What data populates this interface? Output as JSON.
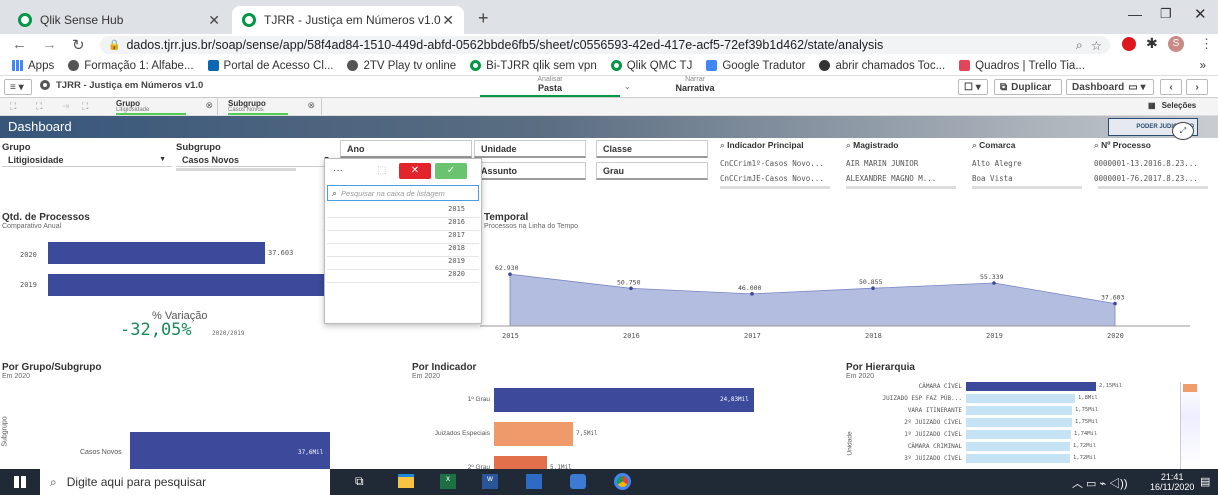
{
  "browser": {
    "tabs": [
      {
        "label": "Qlik Sense Hub"
      },
      {
        "label": "TJRR - Justiça em Números v1.0 -"
      }
    ],
    "url": "dados.tjrr.jus.br/soap/sense/app/58f4ad84-1510-449d-abfd-0562bbde6fb5/sheet/c0556593-42ed-417e-acf5-72ef39b1d462/state/analysis",
    "bookmarks": [
      "Apps",
      "Formação 1: Alfabe...",
      "Portal de Acesso Cl...",
      "2TV Play tv online",
      "Bi-TJRR qlik sem vpn",
      "Qlik QMC TJ",
      "Google Tradutor",
      "abrir chamados Toc...",
      "Quadros | Trello Tia..."
    ],
    "bookmarks_more": "»",
    "profile": "S"
  },
  "qlik": {
    "app_name": "TJRR - Justiça em Números v1.0",
    "analisar": "Analisar",
    "pasta": "Pasta",
    "narrar": "Narrar",
    "narrativa": "Narrativa",
    "duplicar": "Duplicar",
    "dashboard_btn": "Dashboard",
    "selections": [
      {
        "field": "Grupo",
        "value": "Litigiosidade"
      },
      {
        "field": "Subgrupo",
        "value": "Casos Novos"
      }
    ],
    "selecoes": "Seleções",
    "sheet_title": "Dashboard",
    "logo_text": "PODER JUDICIÁRIO"
  },
  "filters": {
    "grupo_label": "Grupo",
    "grupo_value": "Litigiosidade",
    "subgrupo_label": "Subgrupo",
    "subgrupo_value": "Casos Novos",
    "ano": "Ano",
    "unidade": "Unidade",
    "classe": "Classe",
    "assunto": "Assunto",
    "grau": "Grau",
    "indicador_label": "Indicador Principal",
    "indicador_items": [
      "CnCCrim1º-Casos Novo...",
      "CnCCrimJE-Casos Novo..."
    ],
    "magistrado_label": "Magistrado",
    "magistrado_items": [
      "AIR MARIN JUNIOR",
      "ALEXANDRE MAGNO M..."
    ],
    "comarca_label": "Comarca",
    "comarca_items": [
      "Alto Alegre",
      "Boa Vista"
    ],
    "processo_label": "Nº Processo",
    "processo_items": [
      "0000001-13.2016.8.23...",
      "0000001-76.2017.8.23..."
    ]
  },
  "dropdown": {
    "more": "···",
    "search_placeholder": "Pesquisar na caixa de listagem",
    "years": [
      "2015",
      "2016",
      "2017",
      "2018",
      "2019",
      "2020"
    ]
  },
  "qtd": {
    "title": "Qtd. de Processos",
    "subtitle": "Comparativo Anual",
    "bars": [
      {
        "year": "2020",
        "value_label": "37.603",
        "value": 37603
      },
      {
        "year": "2019",
        "value_label": "",
        "value": 55339
      }
    ]
  },
  "variacao": {
    "label": "% Variação",
    "value": "-32,05%",
    "suffix": "2020/2019"
  },
  "temporal": {
    "title": "Temporal",
    "subtitle": "Processos na Linha do Tempo"
  },
  "chart_data": [
    {
      "type": "area",
      "title": "Temporal",
      "subtitle": "Processos na Linha do Tempo",
      "x": [
        "2015",
        "2016",
        "2017",
        "2018",
        "2019",
        "2020"
      ],
      "values": [
        62930,
        50750,
        46000,
        50855,
        55339,
        37603
      ],
      "labels": [
        "62.930",
        "50.750",
        "46.000",
        "50.855",
        "55.339",
        "37.603"
      ],
      "color": "#b3bde0"
    },
    {
      "type": "bar",
      "title": "Por Indicador",
      "subtitle": "Em 2020",
      "categories": [
        "1º Grau",
        "Juizados Especiais",
        "2º Grau"
      ],
      "values": [
        24.83,
        7.5,
        5.1
      ],
      "labels": [
        "24,83Mil",
        "7,5Mil",
        "5,1Mil"
      ]
    },
    {
      "type": "bar",
      "title": "Por Hierarquia",
      "subtitle": "Em 2020",
      "ylabel": "Unidade",
      "categories": [
        "CÂMARA CÍVEL",
        "JUIZADO ESP FAZ PÚB...",
        "VARA ITINERANTE",
        "2º JUIZADO CÍVEL",
        "1º JUIZADO CÍVEL",
        "CÂMARA CRIMINAL",
        "3º JUIZADO CÍVEL"
      ],
      "values": [
        2.15,
        1.8,
        1.75,
        1.75,
        1.74,
        1.72,
        1.72
      ],
      "labels": [
        "2,15Mil",
        "1,8Mil",
        "1,75Mil",
        "1,75Mil",
        "1,74Mil",
        "1,72Mil",
        "1,72Mil"
      ]
    }
  ],
  "grupo_sub": {
    "title": "Por Grupo/Subgrupo",
    "subtitle": "Em 2020",
    "axis": "Subgrupo",
    "bar_label": "Casos Novos",
    "value_label": "37,6Mil"
  },
  "indicador": {
    "title": "Por Indicador",
    "subtitle": "Em 2020"
  },
  "hierarquia": {
    "title": "Por Hierarquia",
    "subtitle": "Em 2020",
    "axis": "Unidade"
  },
  "taskbar": {
    "search": "Digite aqui para pesquisar",
    "time": "21:41",
    "date": "16/11/2020"
  },
  "colors": {
    "bar": "#3c4a9c",
    "orange": "#f09a6c",
    "light": "#c6e2f5",
    "area": "#b3bde0",
    "variacao": "#1a8a5a"
  }
}
